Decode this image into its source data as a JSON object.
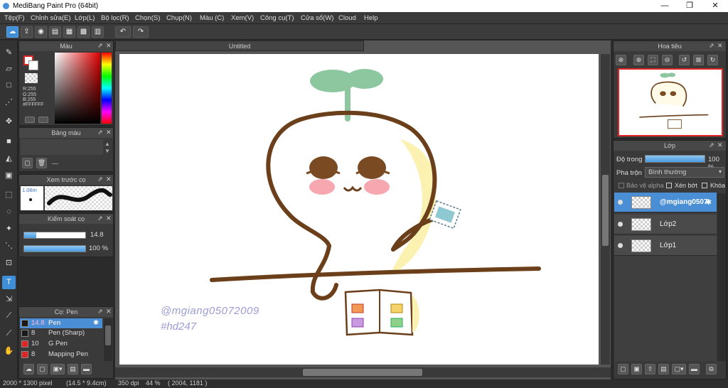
{
  "window": {
    "title": "MediBang Paint Pro (64bit)",
    "minimize": "—",
    "maximize": "❐",
    "close": "✕"
  },
  "menu": [
    "Tệp(F)",
    "Chỉnh sửa(E)",
    "Lớp(L)",
    "Bộ lọc(R)",
    "Chọn(S)",
    "Chụp(N)",
    "Màu (C)",
    "Xem(V)",
    "Công cụ(T)",
    "Cửa sổ(W)",
    "Cloud",
    "Help"
  ],
  "toolbar": {
    "icons": [
      "cloud-icon",
      "share-icon",
      "comment-icon",
      "chat-icon",
      "document-icon",
      "grid-icon",
      "tiles-icon",
      "undo-icon",
      "redo-icon"
    ]
  },
  "color_panel": {
    "title": "Màu",
    "r": "R:255",
    "g": "G:255",
    "b": "B:255",
    "hex": "#FFFFFF"
  },
  "palette_panel": {
    "title": "Bảng màu",
    "placeholder": "---"
  },
  "brush_preview": {
    "title": "Xem trước cọ",
    "size": "1.08m"
  },
  "brush_control": {
    "title": "Kiểm soát cọ",
    "size_value": "14.8",
    "size_fraction": 0.2,
    "opacity_value": "100 %",
    "opacity_fraction": 1.0
  },
  "brush_list": {
    "title": "Cọ: Pen",
    "items": [
      {
        "size": "14.8",
        "name": "Pen",
        "color": "#1a1a1a",
        "selected": true
      },
      {
        "size": "8",
        "name": "Pen (Sharp)",
        "color": "#1a1a1a",
        "selected": false
      },
      {
        "size": "10",
        "name": "G Pen",
        "color": "#e02424",
        "selected": false
      },
      {
        "size": "8",
        "name": "Mapping Pen",
        "color": "#e02424",
        "selected": false
      }
    ]
  },
  "canvas": {
    "tab_title": "Untitled",
    "watermark_line1": "@mgiang05072009",
    "watermark_line2": "#hd247"
  },
  "navigator": {
    "title": "Hoa tiêu"
  },
  "layers_panel": {
    "title": "Lớp",
    "opacity_label": "Độ trong",
    "opacity_value": "100 %",
    "blend_label": "Pha trộn",
    "blend_value": "Bình thường",
    "protect_alpha": "Bảo vệ alpha",
    "clipping": "Xén bớt",
    "lock": "Khóa",
    "layers": [
      {
        "name": "@mgiang0507",
        "selected": true
      },
      {
        "name": "Lớp2",
        "selected": false
      },
      {
        "name": "Lớp1",
        "selected": false
      }
    ]
  },
  "status": {
    "size": "2000 * 1300 pixel",
    "physical": "(14.5 * 9.4cm)",
    "dpi": "350 dpi",
    "zoom": "44 %",
    "coords": "( 2004, 1181 )"
  }
}
